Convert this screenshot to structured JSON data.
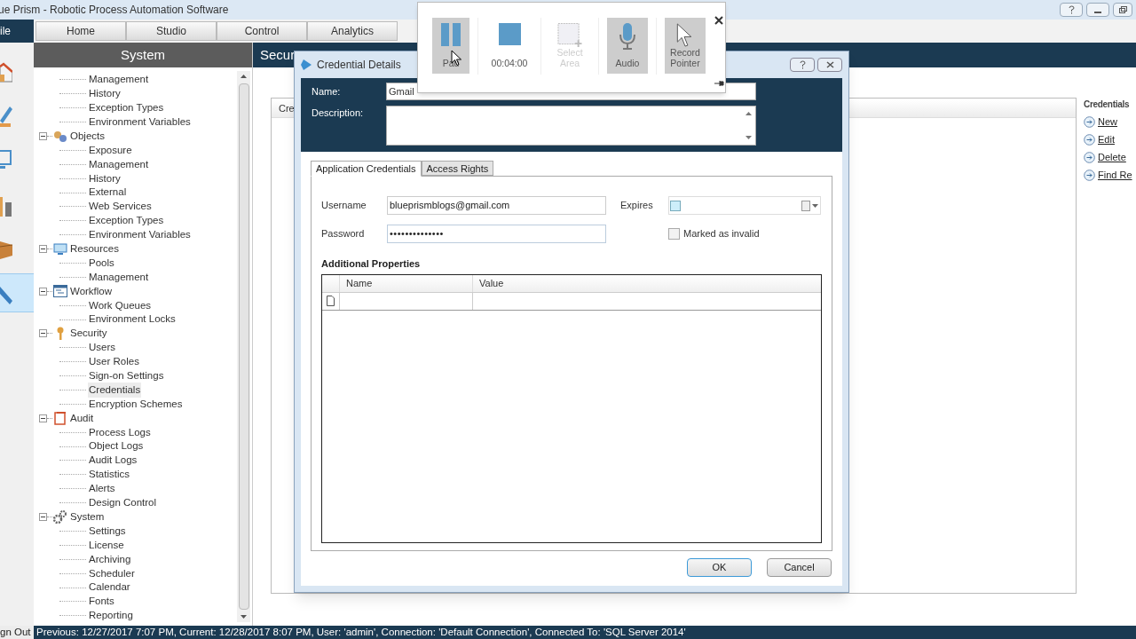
{
  "window": {
    "title": "ue Prism - Robotic Process Automation Software"
  },
  "file_tab": {
    "label": "ile"
  },
  "tabs": [
    {
      "label": "Home",
      "selected": false
    },
    {
      "label": "Studio",
      "selected": false
    },
    {
      "label": "Control",
      "selected": false
    },
    {
      "label": "Analytics",
      "selected": false
    }
  ],
  "nav_rail": [
    {
      "selected": false
    },
    {
      "selected": false
    },
    {
      "selected": false
    },
    {
      "selected": false
    },
    {
      "selected": false
    },
    {
      "selected": true
    }
  ],
  "sidebar": {
    "title": "System",
    "tree": [
      {
        "children": [
          {
            "label": "Management",
            "selected": false
          },
          {
            "label": "History",
            "selected": false
          },
          {
            "label": "Exception Types",
            "selected": false
          },
          {
            "label": "Environment Variables",
            "selected": false
          }
        ]
      },
      {
        "label": "Objects",
        "expanded": true,
        "children": [
          {
            "label": "Exposure",
            "selected": false
          },
          {
            "label": "Management",
            "selected": false
          },
          {
            "label": "History",
            "selected": false
          },
          {
            "label": "External",
            "selected": false
          },
          {
            "label": "Web Services",
            "selected": false
          },
          {
            "label": "Exception Types",
            "selected": false
          },
          {
            "label": "Environment Variables",
            "selected": false
          }
        ]
      },
      {
        "label": "Resources",
        "expanded": true,
        "children": [
          {
            "label": "Pools",
            "selected": false
          },
          {
            "label": "Management",
            "selected": false
          }
        ]
      },
      {
        "label": "Workflow",
        "expanded": true,
        "children": [
          {
            "label": "Work Queues",
            "selected": false
          },
          {
            "label": "Environment Locks",
            "selected": false
          }
        ]
      },
      {
        "label": "Security",
        "expanded": true,
        "children": [
          {
            "label": "Users",
            "selected": false
          },
          {
            "label": "User Roles",
            "selected": false
          },
          {
            "label": "Sign-on Settings",
            "selected": false
          },
          {
            "label": "Credentials",
            "selected": true
          },
          {
            "label": "Encryption Schemes",
            "selected": false
          }
        ]
      },
      {
        "label": "Audit",
        "expanded": true,
        "children": [
          {
            "label": "Process Logs",
            "selected": false
          },
          {
            "label": "Object Logs",
            "selected": false
          },
          {
            "label": "Audit Logs",
            "selected": false
          },
          {
            "label": "Statistics",
            "selected": false
          },
          {
            "label": "Alerts",
            "selected": false
          },
          {
            "label": "Design Control",
            "selected": false
          }
        ]
      },
      {
        "label": "System",
        "expanded": true,
        "children": [
          {
            "label": "Settings",
            "selected": false
          },
          {
            "label": "License",
            "selected": false
          },
          {
            "label": "Archiving",
            "selected": false
          },
          {
            "label": "Scheduler",
            "selected": false
          },
          {
            "label": "Calendar",
            "selected": false
          },
          {
            "label": "Fonts",
            "selected": false
          },
          {
            "label": "Reporting",
            "selected": false
          }
        ]
      }
    ]
  },
  "main": {
    "title": "Secur",
    "panel_header": "Cre",
    "actions": {
      "title": "Credentials",
      "links": [
        "New",
        "Edit",
        "Delete",
        "Find Re"
      ]
    }
  },
  "dialog": {
    "title": "Credential Details",
    "name_label": "Name:",
    "name_value": "Gmail",
    "description_label": "Description:",
    "tabs": [
      {
        "label": "Application Credentials",
        "selected": true
      },
      {
        "label": "Access Rights",
        "selected": false
      }
    ],
    "username_label": "Username",
    "username_value": "blueprismblogs@gmail.com",
    "password_label": "Password",
    "password_value": "••••••••••••••",
    "expires_label": "Expires",
    "expires_checked": false,
    "invalid": {
      "label": "Marked as invalid",
      "checked": false
    },
    "properties": {
      "title": "Additional Properties",
      "columns": [
        "Name",
        "Value"
      ]
    },
    "buttons": [
      {
        "label": "OK",
        "default": true
      },
      {
        "label": "Cancel",
        "default": false
      }
    ]
  },
  "recorder": {
    "buttons": [
      {
        "kind": "pause",
        "label": "Pau",
        "selected": true,
        "disabled": false
      },
      {
        "kind": "stop",
        "label": "00:04:00",
        "selected": false,
        "disabled": false
      },
      {
        "kind": "area",
        "label": "Select Area",
        "selected": false,
        "disabled": true
      },
      {
        "kind": "audio",
        "label": "Audio",
        "selected": true,
        "disabled": false
      },
      {
        "kind": "pointer",
        "label": "Record Pointer",
        "selected": true,
        "disabled": false
      }
    ]
  },
  "status_bar": {
    "sign_out": "gn Out",
    "text": "Previous: 12/27/2017 7:07 PM, Current: 12/28/2017 8:07 PM, User: 'admin', Connection: 'Default Connection', Connected To: 'SQL Server 2014'"
  }
}
